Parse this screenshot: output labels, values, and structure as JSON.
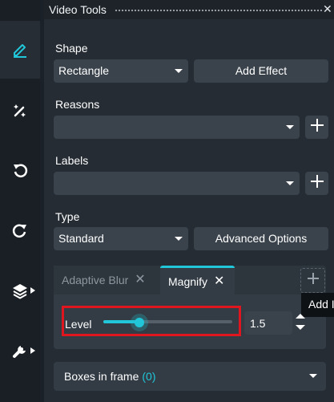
{
  "window": {
    "title": "Video Tools"
  },
  "sidebar": {
    "items": [
      {
        "name": "pencil-icon",
        "active": true
      },
      {
        "name": "magic-wand-icon",
        "active": false
      },
      {
        "name": "undo-icon",
        "active": false
      },
      {
        "name": "redo-icon",
        "active": false
      },
      {
        "name": "layers-icon",
        "active": false
      },
      {
        "name": "wrench-icon",
        "active": false
      }
    ]
  },
  "shape": {
    "label": "Shape",
    "value": "Rectangle",
    "add_effect_label": "Add Effect"
  },
  "reasons": {
    "label": "Reasons",
    "value": ""
  },
  "labels": {
    "label": "Labels",
    "value": ""
  },
  "type": {
    "label": "Type",
    "value": "Standard",
    "advanced_label": "Advanced Options"
  },
  "effects": {
    "tabs": [
      {
        "label": "Adaptive Blur",
        "active": false
      },
      {
        "label": "Magnify",
        "active": true
      }
    ],
    "add_tooltip": "Add I",
    "level": {
      "label": "Level",
      "value": "1.5",
      "fraction": 0.28
    }
  },
  "boxes": {
    "label": "Boxes in frame",
    "count": "(0)"
  },
  "colors": {
    "accent": "#21c6d8",
    "highlight": "#e0161e"
  }
}
